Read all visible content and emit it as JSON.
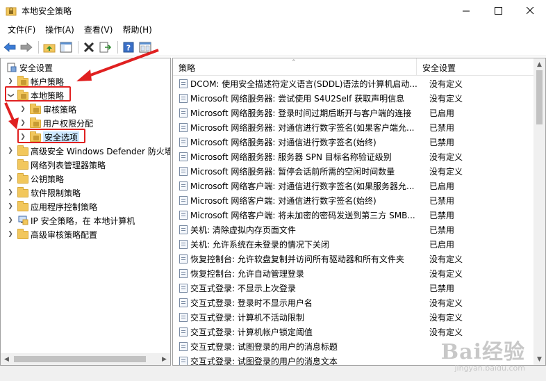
{
  "window": {
    "title": "本地安全策略"
  },
  "menu": [
    {
      "label": "文件(F)"
    },
    {
      "label": "操作(A)"
    },
    {
      "label": "查看(V)"
    },
    {
      "label": "帮助(H)"
    }
  ],
  "tree": {
    "items": [
      {
        "label": "安全设置",
        "level": 0,
        "expander": "expanded-none",
        "icon": "security-settings-icon"
      },
      {
        "label": "帐户策略",
        "level": 1,
        "expander": "collapsed",
        "icon": "folder-lock-icon"
      },
      {
        "label": "本地策略",
        "level": 1,
        "expander": "expanded",
        "icon": "folder-lock-icon"
      },
      {
        "label": "审核策略",
        "level": 2,
        "expander": "collapsed",
        "icon": "folder-lock-icon"
      },
      {
        "label": "用户权限分配",
        "level": 2,
        "expander": "collapsed",
        "icon": "folder-lock-icon"
      },
      {
        "label": "安全选项",
        "level": 2,
        "expander": "collapsed",
        "icon": "folder-lock-icon",
        "selected": true
      },
      {
        "label": "高级安全 Windows Defender 防火墙",
        "level": 1,
        "expander": "collapsed",
        "icon": "folder-icon"
      },
      {
        "label": "网络列表管理器策略",
        "level": 1,
        "expander": "none",
        "icon": "folder-icon"
      },
      {
        "label": "公钥策略",
        "level": 1,
        "expander": "collapsed",
        "icon": "folder-icon"
      },
      {
        "label": "软件限制策略",
        "level": 1,
        "expander": "collapsed",
        "icon": "folder-icon"
      },
      {
        "label": "应用程序控制策略",
        "level": 1,
        "expander": "collapsed",
        "icon": "folder-icon"
      },
      {
        "label": "IP 安全策略，在 本地计算机",
        "level": 1,
        "expander": "collapsed",
        "icon": "ip-security-icon"
      },
      {
        "label": "高级审核策略配置",
        "level": 1,
        "expander": "collapsed",
        "icon": "folder-icon"
      }
    ]
  },
  "list": {
    "columns": [
      "策略",
      "安全设置"
    ],
    "rows": [
      {
        "name": "DCOM: 使用安全描述符定义语言(SDDL)语法的计算机启动...",
        "value": "没有定义"
      },
      {
        "name": "Microsoft 网络服务器: 尝试使用 S4U2Self 获取声明信息",
        "value": "没有定义"
      },
      {
        "name": "Microsoft 网络服务器: 登录时间过期后断开与客户端的连接",
        "value": "已启用"
      },
      {
        "name": "Microsoft 网络服务器: 对通信进行数字签名(如果客户端允...",
        "value": "已禁用"
      },
      {
        "name": "Microsoft 网络服务器: 对通信进行数字签名(始终)",
        "value": "已禁用"
      },
      {
        "name": "Microsoft 网络服务器: 服务器 SPN 目标名称验证级别",
        "value": "没有定义"
      },
      {
        "name": "Microsoft 网络服务器: 暂停会话前所需的空闲时间数量",
        "value": "没有定义"
      },
      {
        "name": "Microsoft 网络客户端: 对通信进行数字签名(如果服务器允...",
        "value": "已启用"
      },
      {
        "name": "Microsoft 网络客户端: 对通信进行数字签名(始终)",
        "value": "已禁用"
      },
      {
        "name": "Microsoft 网络客户端: 将未加密的密码发送到第三方 SMB...",
        "value": "已禁用"
      },
      {
        "name": "关机: 清除虚拟内存页面文件",
        "value": "已禁用"
      },
      {
        "name": "关机: 允许系统在未登录的情况下关闭",
        "value": "已启用"
      },
      {
        "name": "恢复控制台: 允许软盘复制并访问所有驱动器和所有文件夹",
        "value": "没有定义"
      },
      {
        "name": "恢复控制台: 允许自动管理登录",
        "value": "没有定义"
      },
      {
        "name": "交互式登录: 不显示上次登录",
        "value": "已禁用"
      },
      {
        "name": "交互式登录: 登录时不显示用户名",
        "value": "没有定义"
      },
      {
        "name": "交互式登录: 计算机不活动限制",
        "value": "没有定义"
      },
      {
        "name": "交互式登录: 计算机帐户锁定阈值",
        "value": "没有定义"
      },
      {
        "name": "交互式登录: 试图登录的用户的消息标题",
        "value": ""
      },
      {
        "name": "交互式登录: 试图登录的用户的消息文本",
        "value": ""
      }
    ]
  },
  "watermark": {
    "logo": "Bai经验",
    "url": "jingyan.baidu.com"
  },
  "colors": {
    "annotation": "#e02020",
    "folder": "#f2c75c",
    "selection": "#cce8ff"
  }
}
